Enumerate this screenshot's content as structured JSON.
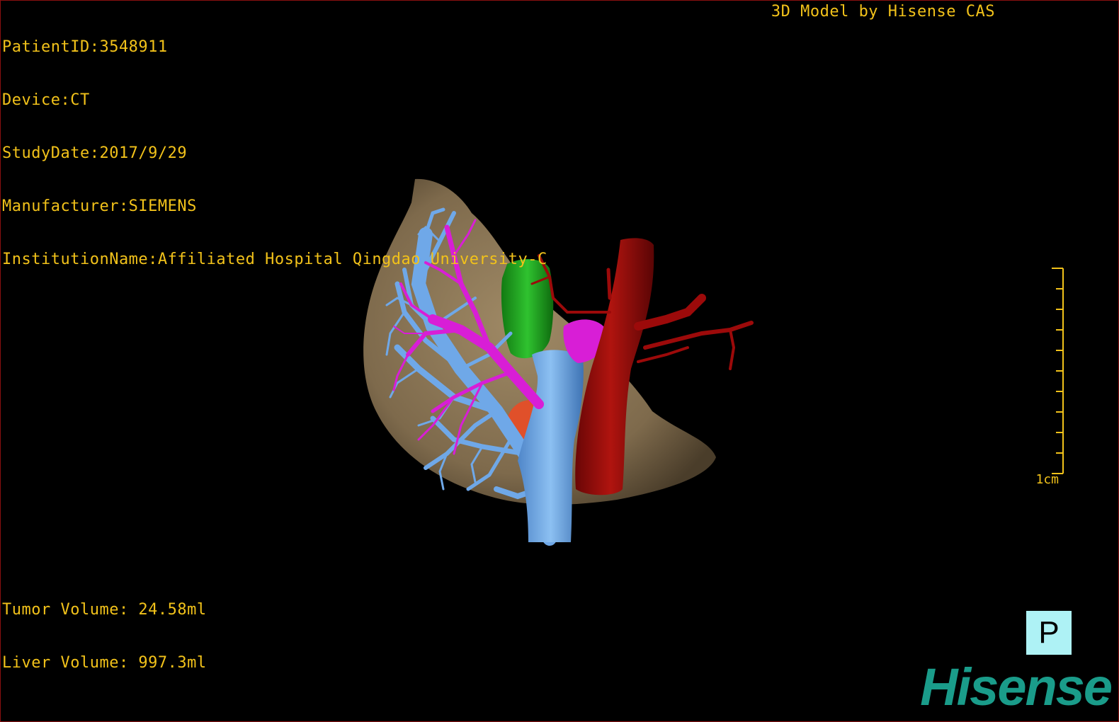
{
  "patient": {
    "id_line": "PatientID:3548911",
    "device_line": "Device:CT",
    "study_date_line": "StudyDate:2017/9/29",
    "manufacturer_line": "Manufacturer:SIEMENS",
    "institution_line": "InstitutionName:Affiliated Hospital Qingdao University-C"
  },
  "credit": "3D Model by Hisense CAS",
  "volumes": {
    "tumor_line": "Tumor Volume: 24.58ml",
    "liver_line": "Liver Volume: 997.3ml"
  },
  "scale_bar": {
    "label": "1cm"
  },
  "orientation": {
    "label": "P"
  },
  "logo": "Hisense",
  "colors": {
    "overlay_text": "#f2c21a",
    "liver": "#8a7555",
    "portal_vein": "#6fa8e8",
    "hepatic_vein": "#d81ed6",
    "artery": "#9c0a0a",
    "gallbladder": "#1fa31f",
    "tumor": "#e0502a",
    "orientation_bg": "#aef2f5",
    "logo": "#1a9c8a"
  }
}
